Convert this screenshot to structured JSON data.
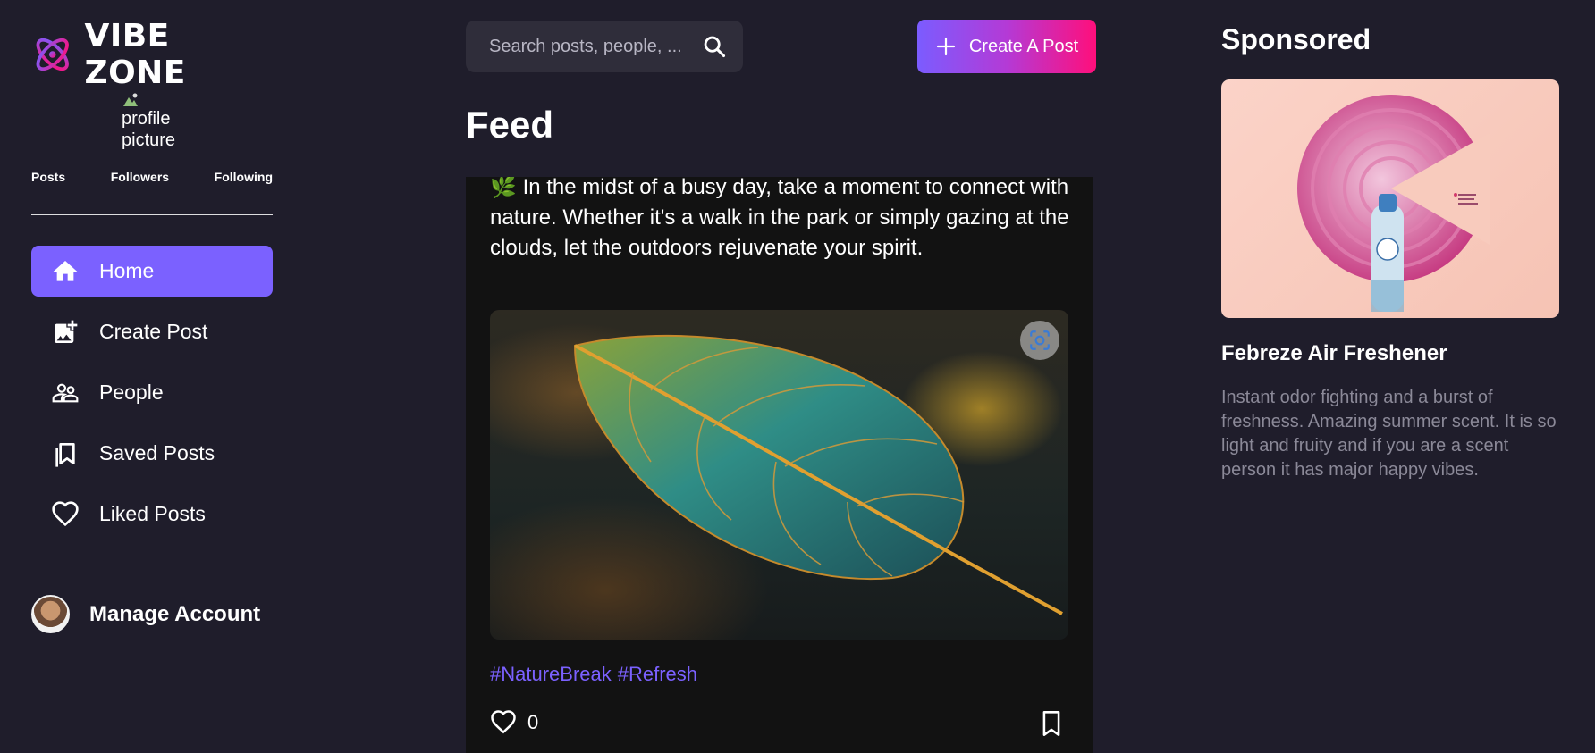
{
  "app": {
    "name": "VIBE ZONE"
  },
  "profile": {
    "image_alt": "profile picture"
  },
  "stats": {
    "posts_label": "Posts",
    "followers_label": "Followers",
    "following_label": "Following"
  },
  "sidebar": {
    "items": [
      {
        "label": "Home",
        "icon": "home-icon",
        "active": true
      },
      {
        "label": "Create Post",
        "icon": "add-photo-icon",
        "active": false
      },
      {
        "label": "People",
        "icon": "people-icon",
        "active": false
      },
      {
        "label": "Saved Posts",
        "icon": "bookmarks-icon",
        "active": false
      },
      {
        "label": "Liked Posts",
        "icon": "heart-icon",
        "active": false
      }
    ],
    "manage_account": "Manage Account"
  },
  "search": {
    "placeholder": "Search posts, people, ..."
  },
  "header": {
    "create_button": "Create A Post",
    "feed_title": "Feed"
  },
  "post": {
    "emoji": "🌿",
    "text": "In the midst of a busy day, take a moment to connect with nature. Whether it's a walk in the park or simply gazing at the clouds, let the outdoors rejuvenate your spirit.",
    "hashtags": [
      "#NatureBreak",
      "#Refresh"
    ],
    "likes": "0"
  },
  "sponsored": {
    "title": "Sponsored",
    "ad_name": "Febreze Air Freshener",
    "ad_description": "Instant odor fighting and a burst of freshness. Amazing summer scent. It is so light and fruity and if you are a scent person it has major happy vibes."
  },
  "colors": {
    "background": "#1f1d2b",
    "accent": "#7b61ff",
    "gradient_end": "#ff0f7b",
    "post_bg": "#121212"
  }
}
